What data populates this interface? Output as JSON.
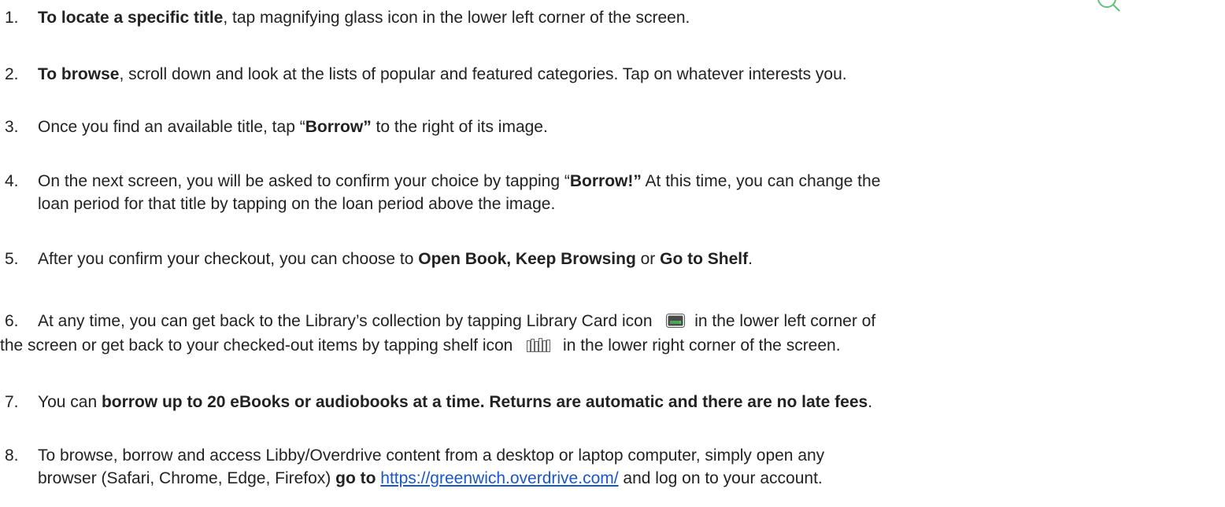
{
  "icons": {
    "search": "magnifying-glass-icon",
    "card": "library-card-icon",
    "shelf": "shelf-icon",
    "accent_green": "#4caf50"
  },
  "items": [
    {
      "num": "1.",
      "bold": "To locate a specific title",
      "text": ", tap magnifying glass icon in the lower left corner of the screen."
    },
    {
      "num": "2.",
      "bold": "To browse",
      "text": ", scroll down and look at the lists of popular and featured categories. Tap on whatever interests you."
    },
    {
      "num": "3.",
      "pre": "Once you find an available title, tap “",
      "bold": "Borrow”",
      "post": " to the right of its image."
    },
    {
      "num": "4.",
      "pre": "On the next screen, you will be asked to confirm your choice by tapping “",
      "bold": "Borrow!”",
      "post": " At this time, you can change the",
      "line2": "loan period for that title by tapping on the loan period above the image."
    },
    {
      "num": "5.",
      "pre": "After you confirm your checkout, you can choose to ",
      "bold1": "Open Book, Keep Browsing",
      "mid": " or ",
      "bold2": "Go to Shelf",
      "post": "."
    },
    {
      "num": "6.",
      "pre": "At any time, you can get back to the Library’s collection by tapping Library Card icon",
      "post": "in the lower left corner of",
      "line2_pre": "the screen or get back to your checked-out items by tapping shelf icon",
      "line2_post": "in the lower right corner of the screen."
    },
    {
      "num": "7.",
      "pre": "You can ",
      "bold": "borrow up to 20 eBooks or audiobooks at a time. Returns are automatic and there are no late fees",
      "post": "."
    },
    {
      "num": "8.",
      "line1": "To browse, borrow and access Libby/Overdrive content from a desktop or laptop computer, simply open any",
      "line2_pre": "browser (Safari, Chrome, Edge, Firefox) ",
      "line2_bold": "go to",
      "line2_space": " ",
      "link": "https://greenwich.overdrive.com/",
      "line2_post": " and log on to your account."
    }
  ]
}
